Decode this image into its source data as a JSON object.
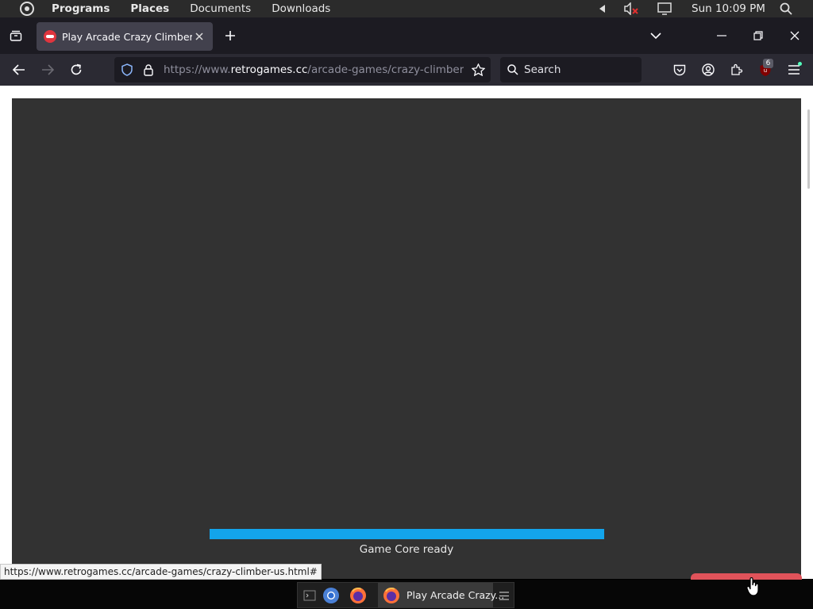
{
  "panel": {
    "menus": [
      "Programs",
      "Places",
      "Documents",
      "Downloads"
    ],
    "clock": "Sun 10:09 PM",
    "icons": [
      "distributor-logo-icon",
      "volume-left-arrow-icon",
      "volume-muted-icon",
      "display-icon",
      "search-icon"
    ]
  },
  "tabbar": {
    "tab_title": "Play Arcade Crazy Climber (US)",
    "icons": [
      "tab-overview-icon",
      "site-favicon-icon",
      "close-icon",
      "new-tab-plus-icon",
      "list-all-tabs-chevron-icon",
      "minimize-icon",
      "restore-icon",
      "window-close-icon"
    ]
  },
  "navbar": {
    "url_scheme": "https://www.",
    "url_host": "retrogames.cc",
    "url_path": "/arcade-games/crazy-climber-us.html#",
    "search_placeholder": "Search",
    "extension_badge": "6",
    "icons": [
      "back-arrow-icon",
      "forward-arrow-icon",
      "reload-icon",
      "tracking-shield-icon",
      "lock-icon",
      "bookmark-star-icon",
      "pocket-icon",
      "account-icon",
      "extensions-puzzle-icon",
      "ublock-icon",
      "hamburger-menu-icon"
    ]
  },
  "game": {
    "status": "Game Core ready",
    "progress_fraction": 1.0,
    "progress_color": "#13a4eb",
    "background_color": "#323232"
  },
  "status_tooltip": "https://www.retrogames.cc/arcade-games/crazy-climber-us.html#",
  "taskbar": {
    "active_task_label": "Play Arcade Crazy...",
    "icons": [
      "terminal-icon",
      "chromium-icon",
      "firefox-icon",
      "firefox-icon",
      "taskbar-menu-icon"
    ]
  },
  "colors": {
    "accent": "#13a4eb",
    "chrome_dark": "#1c1b22",
    "toolbar": "#2b2a33",
    "selected_tab": "#42414d"
  }
}
